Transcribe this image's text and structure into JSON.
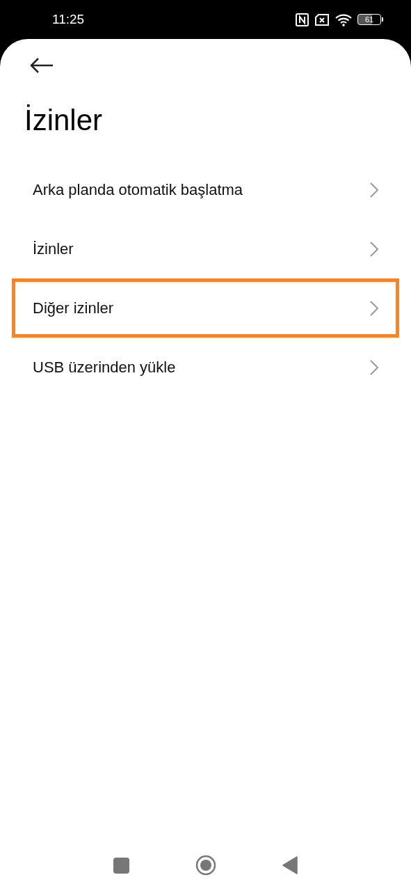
{
  "status_bar": {
    "time": "11:25",
    "battery": "61"
  },
  "title": "İzinler",
  "items": [
    {
      "label": "Arka planda otomatik başlatma",
      "highlighted": false
    },
    {
      "label": "İzinler",
      "highlighted": false
    },
    {
      "label": "Diğer izinler",
      "highlighted": true
    },
    {
      "label": "USB üzerinden yükle",
      "highlighted": false
    }
  ]
}
